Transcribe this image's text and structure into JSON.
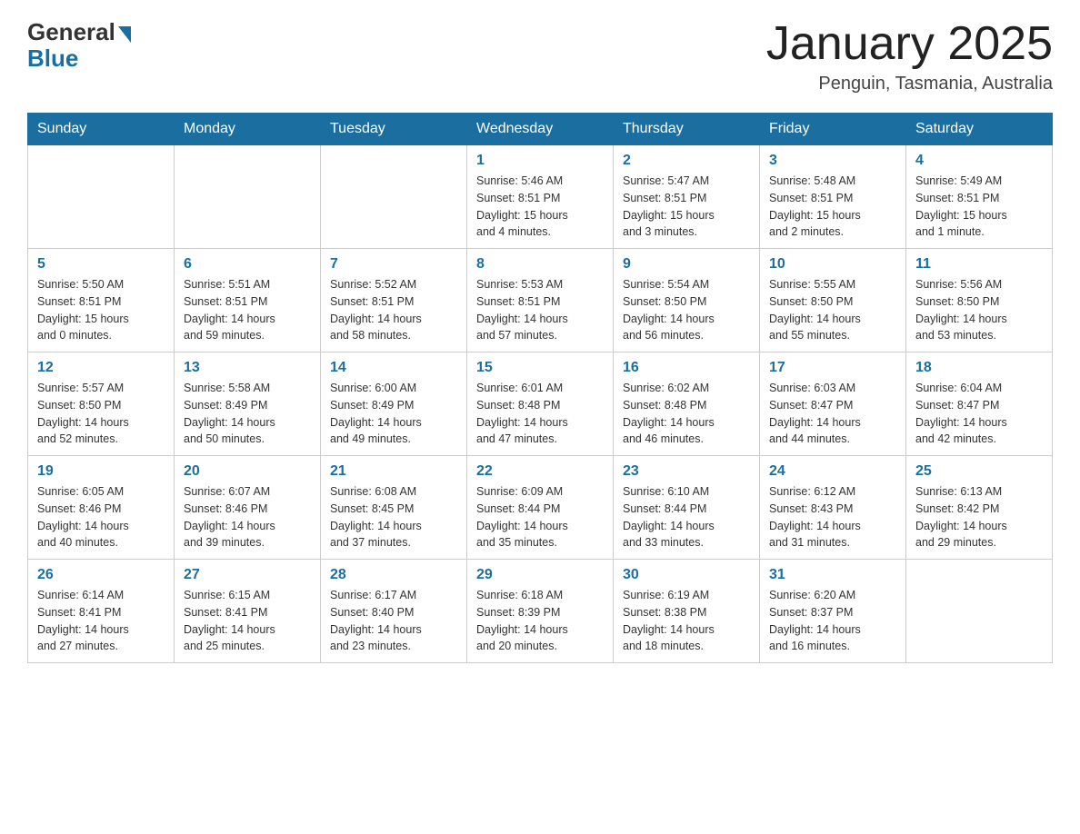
{
  "header": {
    "logo_general": "General",
    "logo_blue": "Blue",
    "month_title": "January 2025",
    "location": "Penguin, Tasmania, Australia"
  },
  "weekdays": [
    "Sunday",
    "Monday",
    "Tuesday",
    "Wednesday",
    "Thursday",
    "Friday",
    "Saturday"
  ],
  "weeks": [
    [
      {
        "day": "",
        "info": ""
      },
      {
        "day": "",
        "info": ""
      },
      {
        "day": "",
        "info": ""
      },
      {
        "day": "1",
        "info": "Sunrise: 5:46 AM\nSunset: 8:51 PM\nDaylight: 15 hours\nand 4 minutes."
      },
      {
        "day": "2",
        "info": "Sunrise: 5:47 AM\nSunset: 8:51 PM\nDaylight: 15 hours\nand 3 minutes."
      },
      {
        "day": "3",
        "info": "Sunrise: 5:48 AM\nSunset: 8:51 PM\nDaylight: 15 hours\nand 2 minutes."
      },
      {
        "day": "4",
        "info": "Sunrise: 5:49 AM\nSunset: 8:51 PM\nDaylight: 15 hours\nand 1 minute."
      }
    ],
    [
      {
        "day": "5",
        "info": "Sunrise: 5:50 AM\nSunset: 8:51 PM\nDaylight: 15 hours\nand 0 minutes."
      },
      {
        "day": "6",
        "info": "Sunrise: 5:51 AM\nSunset: 8:51 PM\nDaylight: 14 hours\nand 59 minutes."
      },
      {
        "day": "7",
        "info": "Sunrise: 5:52 AM\nSunset: 8:51 PM\nDaylight: 14 hours\nand 58 minutes."
      },
      {
        "day": "8",
        "info": "Sunrise: 5:53 AM\nSunset: 8:51 PM\nDaylight: 14 hours\nand 57 minutes."
      },
      {
        "day": "9",
        "info": "Sunrise: 5:54 AM\nSunset: 8:50 PM\nDaylight: 14 hours\nand 56 minutes."
      },
      {
        "day": "10",
        "info": "Sunrise: 5:55 AM\nSunset: 8:50 PM\nDaylight: 14 hours\nand 55 minutes."
      },
      {
        "day": "11",
        "info": "Sunrise: 5:56 AM\nSunset: 8:50 PM\nDaylight: 14 hours\nand 53 minutes."
      }
    ],
    [
      {
        "day": "12",
        "info": "Sunrise: 5:57 AM\nSunset: 8:50 PM\nDaylight: 14 hours\nand 52 minutes."
      },
      {
        "day": "13",
        "info": "Sunrise: 5:58 AM\nSunset: 8:49 PM\nDaylight: 14 hours\nand 50 minutes."
      },
      {
        "day": "14",
        "info": "Sunrise: 6:00 AM\nSunset: 8:49 PM\nDaylight: 14 hours\nand 49 minutes."
      },
      {
        "day": "15",
        "info": "Sunrise: 6:01 AM\nSunset: 8:48 PM\nDaylight: 14 hours\nand 47 minutes."
      },
      {
        "day": "16",
        "info": "Sunrise: 6:02 AM\nSunset: 8:48 PM\nDaylight: 14 hours\nand 46 minutes."
      },
      {
        "day": "17",
        "info": "Sunrise: 6:03 AM\nSunset: 8:47 PM\nDaylight: 14 hours\nand 44 minutes."
      },
      {
        "day": "18",
        "info": "Sunrise: 6:04 AM\nSunset: 8:47 PM\nDaylight: 14 hours\nand 42 minutes."
      }
    ],
    [
      {
        "day": "19",
        "info": "Sunrise: 6:05 AM\nSunset: 8:46 PM\nDaylight: 14 hours\nand 40 minutes."
      },
      {
        "day": "20",
        "info": "Sunrise: 6:07 AM\nSunset: 8:46 PM\nDaylight: 14 hours\nand 39 minutes."
      },
      {
        "day": "21",
        "info": "Sunrise: 6:08 AM\nSunset: 8:45 PM\nDaylight: 14 hours\nand 37 minutes."
      },
      {
        "day": "22",
        "info": "Sunrise: 6:09 AM\nSunset: 8:44 PM\nDaylight: 14 hours\nand 35 minutes."
      },
      {
        "day": "23",
        "info": "Sunrise: 6:10 AM\nSunset: 8:44 PM\nDaylight: 14 hours\nand 33 minutes."
      },
      {
        "day": "24",
        "info": "Sunrise: 6:12 AM\nSunset: 8:43 PM\nDaylight: 14 hours\nand 31 minutes."
      },
      {
        "day": "25",
        "info": "Sunrise: 6:13 AM\nSunset: 8:42 PM\nDaylight: 14 hours\nand 29 minutes."
      }
    ],
    [
      {
        "day": "26",
        "info": "Sunrise: 6:14 AM\nSunset: 8:41 PM\nDaylight: 14 hours\nand 27 minutes."
      },
      {
        "day": "27",
        "info": "Sunrise: 6:15 AM\nSunset: 8:41 PM\nDaylight: 14 hours\nand 25 minutes."
      },
      {
        "day": "28",
        "info": "Sunrise: 6:17 AM\nSunset: 8:40 PM\nDaylight: 14 hours\nand 23 minutes."
      },
      {
        "day": "29",
        "info": "Sunrise: 6:18 AM\nSunset: 8:39 PM\nDaylight: 14 hours\nand 20 minutes."
      },
      {
        "day": "30",
        "info": "Sunrise: 6:19 AM\nSunset: 8:38 PM\nDaylight: 14 hours\nand 18 minutes."
      },
      {
        "day": "31",
        "info": "Sunrise: 6:20 AM\nSunset: 8:37 PM\nDaylight: 14 hours\nand 16 minutes."
      },
      {
        "day": "",
        "info": ""
      }
    ]
  ]
}
